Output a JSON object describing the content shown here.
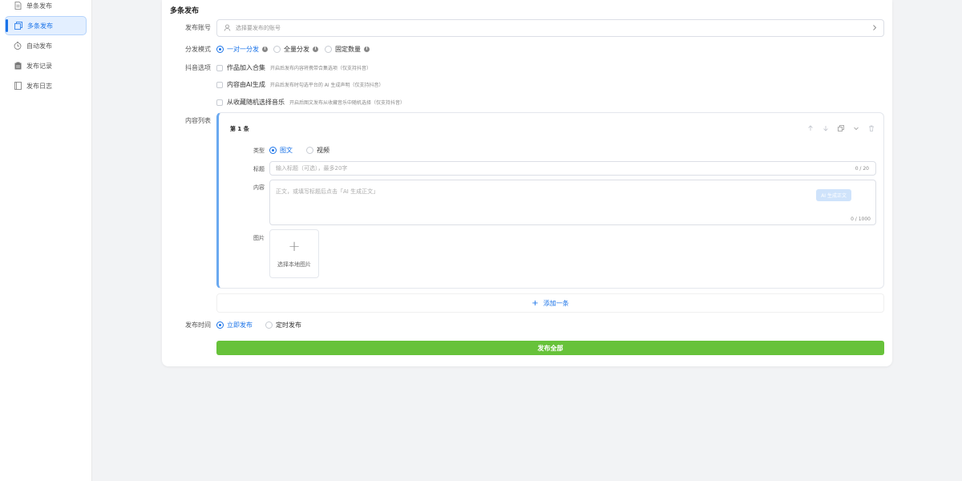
{
  "sidebar": {
    "items": [
      {
        "label": "单条发布",
        "icon": "document-icon",
        "active": false
      },
      {
        "label": "多条发布",
        "icon": "multi-copy-icon",
        "active": true
      },
      {
        "label": "自动发布",
        "icon": "timer-icon",
        "active": false
      },
      {
        "label": "发布记录",
        "icon": "clipboard-icon",
        "active": false
      },
      {
        "label": "发布日志",
        "icon": "book-icon",
        "active": false
      }
    ]
  },
  "page": {
    "title": "多条发布"
  },
  "form": {
    "account": {
      "label": "发布账号",
      "placeholder": "选择要发布的账号"
    },
    "mode": {
      "label": "分发模式",
      "options": [
        {
          "label": "一对一分发",
          "selected": true
        },
        {
          "label": "全量分发",
          "selected": false
        },
        {
          "label": "固定数量",
          "selected": false
        }
      ]
    },
    "douyin": {
      "label": "抖音选项",
      "options": [
        {
          "label": "作品加入合集",
          "hint": "开启后发布内容将携带合集选项（仅支持抖音）",
          "checked": false
        },
        {
          "label": "内容由AI生成",
          "hint": "开启后发布时勾选平台的 AI 生成声明（仅支持抖音）",
          "checked": false
        },
        {
          "label": "从收藏随机选择音乐",
          "hint": "开启后图文发布从收藏音乐中随机选择（仅支持抖音）",
          "checked": false
        }
      ]
    },
    "content_list": {
      "label": "内容列表",
      "items": [
        {
          "title": "第 1 条",
          "type_label": "类型",
          "types": [
            {
              "label": "图文",
              "selected": true
            },
            {
              "label": "视频",
              "selected": false
            }
          ],
          "title_label": "标题",
          "title_placeholder": "输入标题（可选），最多20字",
          "title_count": "0 / 20",
          "content_label": "内容",
          "content_placeholder": "正文，或填写标题后点击「AI 生成正文」",
          "ai_button": "AI 生成正文",
          "content_count": "0 / 1000",
          "image_label": "图片",
          "upload_label": "选择本地图片"
        }
      ],
      "add_label": "添加一条"
    },
    "publish_time": {
      "label": "发布时间",
      "options": [
        {
          "label": "立即发布",
          "selected": true
        },
        {
          "label": "定时发布",
          "selected": false
        }
      ]
    },
    "publish_button": "发布全部"
  },
  "colors": {
    "accent": "#1a73e8",
    "publish": "#67c23a",
    "card_border": "#6aa9f0"
  }
}
